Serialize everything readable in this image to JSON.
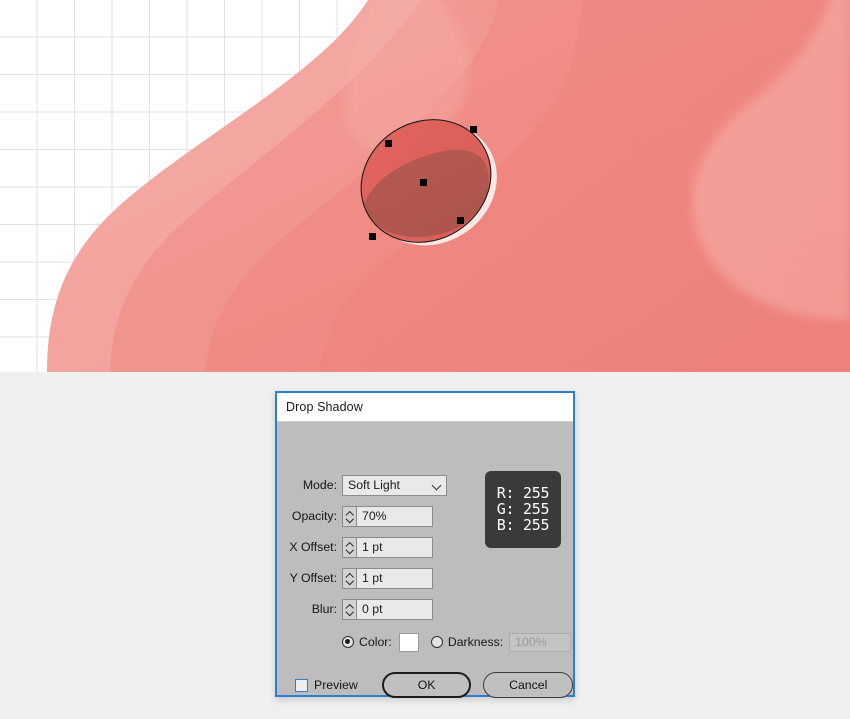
{
  "canvas": {
    "name": "artboard-canvas",
    "grid_color": "#e2e2e2",
    "background": "#ffffff",
    "selected_shape": "ellipse",
    "anchor_color": "#000000",
    "palette": {
      "base_pink": "#f4a7a1",
      "mid_salmon": "#f18f88",
      "deep_salmon": "#ef8079",
      "highlight_pink": "#f7b4ae",
      "ellipse_light": "#e0635e",
      "ellipse_dark": "#b0574f",
      "shadow_white": "#fdecea"
    }
  },
  "dialog": {
    "title": "Drop Shadow",
    "border_color": "#2a7fd4",
    "body_color": "#bdbdbd",
    "fields": {
      "mode": {
        "label": "Mode:",
        "value": "Soft Light",
        "icon": "chevron-down-icon"
      },
      "opacity": {
        "label": "Opacity:",
        "value": "70%"
      },
      "x_offset": {
        "label": "X Offset:",
        "value": "1 pt"
      },
      "y_offset": {
        "label": "Y Offset:",
        "value": "1 pt"
      },
      "blur": {
        "label": "Blur:",
        "value": "0 pt"
      }
    },
    "color_row": {
      "color_label": "Color:",
      "color_selected": true,
      "color_swatch": "#ffffff",
      "darkness_label": "Darkness:",
      "darkness_selected": false,
      "darkness_value": "100%",
      "darkness_enabled": false
    },
    "footer": {
      "preview_label": "Preview",
      "preview_checked": false,
      "ok_label": "OK",
      "cancel_label": "Cancel"
    }
  },
  "rgb_tooltip": {
    "r": "R: 255",
    "g": "G: 255",
    "b": "B: 255",
    "background": "#3a3a3a"
  }
}
